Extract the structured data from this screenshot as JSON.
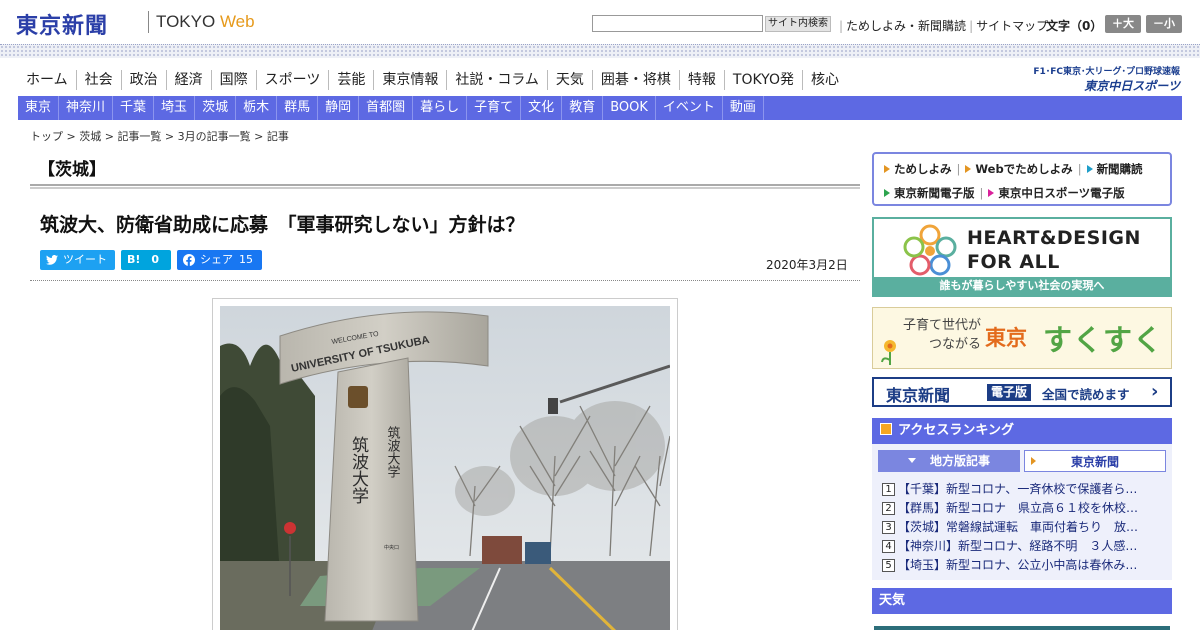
{
  "header": {
    "logo": "東京新聞",
    "site_name": "TOKYO",
    "site_name_suffix": "Web",
    "search_placeholder": "",
    "search_button": "サイト内検索",
    "links": [
      "ためしよみ・新聞購読",
      "サイトマップ"
    ],
    "font_size_label": "文字（0）",
    "font_larger": "＋大",
    "font_smaller": "－小"
  },
  "main_nav": [
    "ホーム",
    "社会",
    "政治",
    "経済",
    "国際",
    "スポーツ",
    "芸能",
    "東京情報",
    "社説・コラム",
    "天気",
    "囲碁・将棋",
    "特報",
    "TOKYO発",
    "核心"
  ],
  "chunichi": {
    "top": "F1･FC東京･大リーグ･プロ野球速報",
    "main": "東京中日スポーツ"
  },
  "region_nav": [
    "東京",
    "神奈川",
    "千葉",
    "埼玉",
    "茨城",
    "栃木",
    "群馬",
    "静岡",
    "首都圏",
    "暮らし",
    "子育て",
    "文化",
    "教育",
    "BOOK",
    "イベント",
    "動画"
  ],
  "breadcrumb": [
    "トップ",
    "茨城",
    "記事一覧",
    "3月の記事一覧",
    "記事"
  ],
  "breadcrumb_sep": " > ",
  "article": {
    "region": "【茨城】",
    "headline": "筑波大、防衛省助成に応募　「軍事研究しない」方針は？",
    "date": "2020年3月2日",
    "share": {
      "tweet_label": "ツイート",
      "hatena_label": "B!",
      "hatena_count": "0",
      "facebook_label": "シェア",
      "facebook_count": "15"
    },
    "photo": {
      "arch_text": "UNIVERSITY OF TSUKUBA",
      "arch_welcome": "WELCOME TO",
      "pillar_left": "筑波大学",
      "pillar_right": "筑波大学",
      "pillar_sign": "中央口"
    }
  },
  "sidebar": {
    "links_row1": [
      "ためしよみ",
      "Webでためしよみ",
      "新聞購読"
    ],
    "links_row2": [
      "東京新聞電子版",
      "東京中日スポーツ電子版"
    ],
    "link_colors": [
      "#e39522",
      "#e39522",
      "#1f9ec9",
      "#2da44e",
      "#d9219b"
    ],
    "hd_banner": {
      "line1": "HEART&DESIGN",
      "line2": "FOR ALL",
      "strip": "誰もが暮らしやすい社会の実現へ"
    },
    "sukusuku": {
      "sub_line1": "子育て世代が",
      "sub_line2": "つながる",
      "tokyo": "東京",
      "main": "すくすく"
    },
    "denshi": {
      "logo": "東京新聞",
      "tag": "電子版",
      "text": "全国で読めます"
    },
    "ranking": {
      "title": "アクセスランキング",
      "tab_active": "地方版記事",
      "tab_inactive": "東京新聞",
      "items": [
        "【千葉】新型コロナ、一斉休校で保護者ら…",
        "【群馬】新型コロナ　県立高６１校を休校…",
        "【茨城】常磐線試運転　車両付着ちり　放…",
        "【神奈川】新型コロナ、経路不明　３人感…",
        "【埼玉】新型コロナ、公立小中高は春休み…"
      ]
    },
    "weather_title": "天気"
  },
  "colors": {
    "nav_accent": "#5d69e3",
    "logo_blue": "#2b3fa8",
    "web_orange": "#e69a1c"
  }
}
